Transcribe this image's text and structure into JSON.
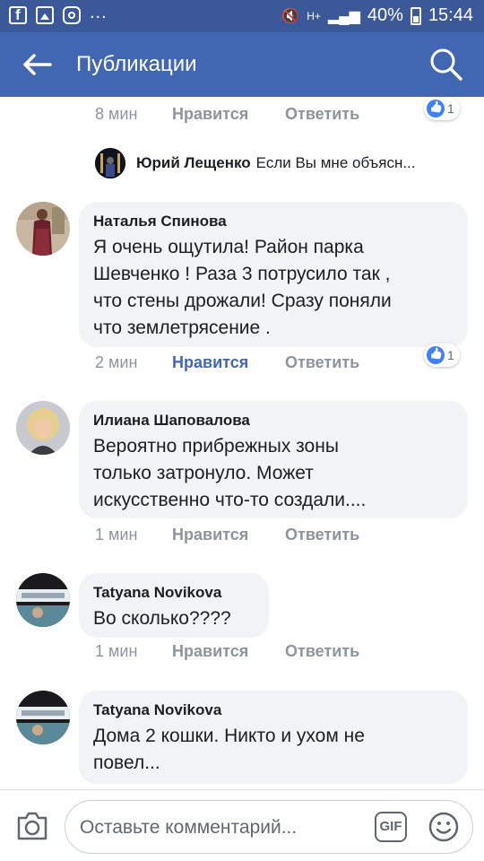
{
  "status_bar": {
    "battery": "40%",
    "time": "15:44",
    "more": "...",
    "signal_label": "H+"
  },
  "header": {
    "title": "Публикации"
  },
  "comments": [
    {
      "time": "8 мин",
      "like_label": "Нравится",
      "reply_label": "Ответить",
      "reactions": "1",
      "liked": false,
      "reply_preview": {
        "name": "Юрий Лещенко",
        "text": "Если Вы мне объясн..."
      }
    },
    {
      "author": "Наталья Спинова",
      "text": "Я очень ощутила! Район парка\nШевченко ! Раза 3 потрусило так ,\nчто стены дрожали! Сразу поняли\nчто землетрясение .",
      "time": "2 мин",
      "like_label": "Нравится",
      "reply_label": "Ответить",
      "reactions": "1",
      "liked": true
    },
    {
      "author": "Илиана Шаповалова",
      "text": "Вероятно прибрежных зоны\nтолько затронуло. Может\nискусственно что-то создали....",
      "time": "1 мин",
      "like_label": "Нравится",
      "reply_label": "Ответить",
      "liked": false
    },
    {
      "author": "Tatyana Novikova",
      "text": "Во сколько????",
      "time": "1 мин",
      "like_label": "Нравится",
      "reply_label": "Ответить",
      "liked": false
    },
    {
      "author": "Tatyana Novikova",
      "text": "Дома 2 кошки. Никто и ухом не\nповел..."
    }
  ],
  "composer": {
    "placeholder": "Оставьте комментарий...",
    "gif_label": "GIF"
  },
  "colors": {
    "brand": "#4267b2",
    "status_bar": "#3b5998",
    "bubble": "#f2f3f5",
    "meta": "#8d949e"
  }
}
